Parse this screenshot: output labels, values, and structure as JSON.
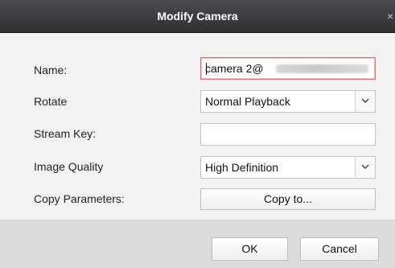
{
  "window": {
    "title": "Modify Camera",
    "close_glyph": "×"
  },
  "form": {
    "name_label": "Name:",
    "name_value": "camera 2@",
    "rotate_label": "Rotate",
    "rotate_value": "Normal Playback",
    "stream_key_label": "Stream Key:",
    "stream_key_value": "",
    "image_quality_label": "Image Quality",
    "image_quality_value": "High Definition",
    "copy_params_label": "Copy Parameters:",
    "copy_to_label": "Copy to..."
  },
  "footer": {
    "ok_label": "OK",
    "cancel_label": "Cancel"
  },
  "colors": {
    "titlebar": "#3a3c40",
    "active_border": "#e07070"
  }
}
